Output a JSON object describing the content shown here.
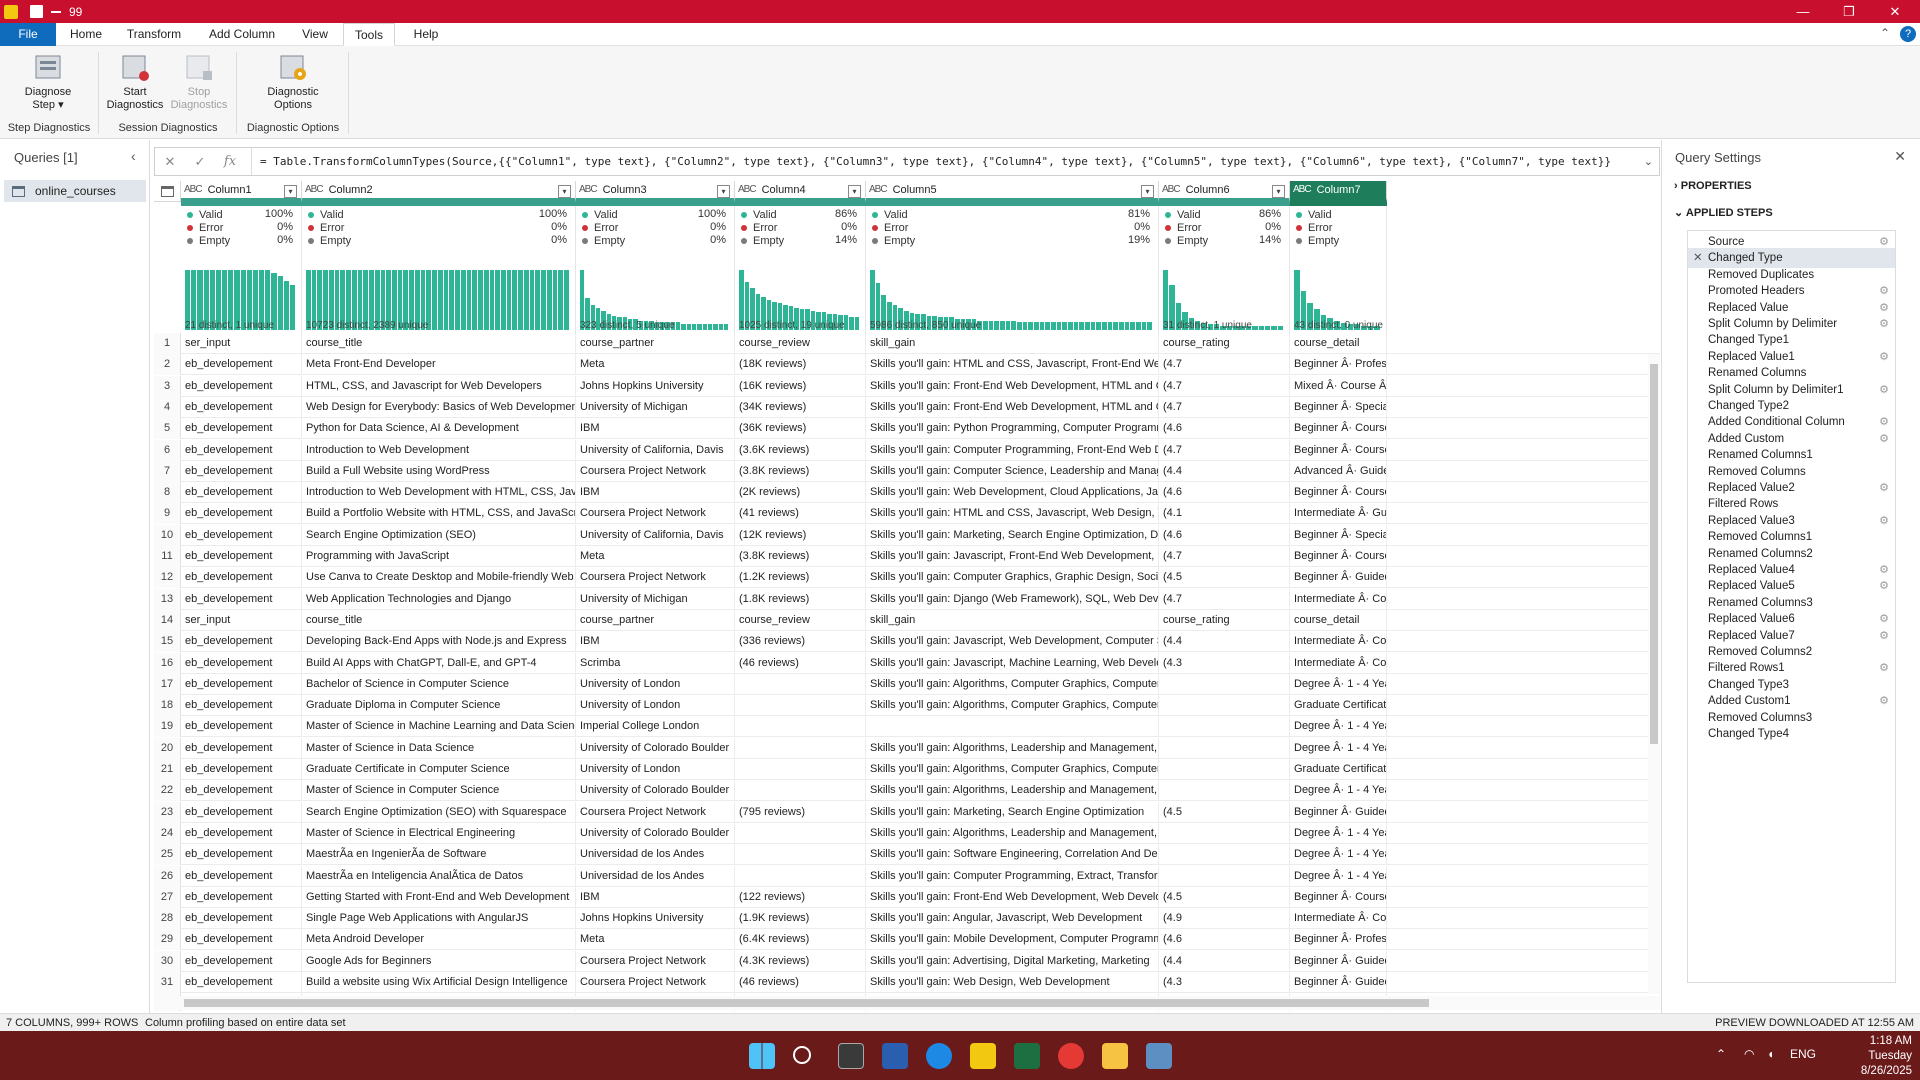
{
  "window": {
    "title": "99",
    "colors": {
      "titlebar": "#c8102e",
      "accent": "#0f6cbd",
      "profile_bar": "#2db596",
      "selected_header": "#1e7e5c"
    }
  },
  "menu": {
    "tabs": [
      "File",
      "Home",
      "Transform",
      "Add Column",
      "View",
      "Tools",
      "Help"
    ],
    "active": "Tools"
  },
  "ribbon": {
    "buttons": [
      {
        "label": "Diagnose\nStep ▾",
        "icon": "diagnose-icon",
        "enabled": true
      },
      {
        "label": "Start\nDiagnostics",
        "icon": "start-diagnostics-icon",
        "enabled": true
      },
      {
        "label": "Stop\nDiagnostics",
        "icon": "stop-diagnostics-icon",
        "enabled": false
      },
      {
        "label": "Diagnostic\nOptions",
        "icon": "diagnostic-options-icon",
        "enabled": true
      }
    ],
    "groups": [
      "Step Diagnostics",
      "Session Diagnostics",
      "Diagnostic Options"
    ]
  },
  "queries": {
    "header": "Queries [1]",
    "items": [
      "online_courses"
    ]
  },
  "formula": "= Table.TransformColumnTypes(Source,{{\"Column1\", type text}, {\"Column2\", type text}, {\"Column3\", type text}, {\"Column4\", type text}, {\"Column5\", type text}, {\"Column6\", type text}, {\"Column7\", type text}}",
  "columns": [
    {
      "name": "Column1",
      "valid": "100%",
      "error": "0%",
      "empty": "0%",
      "distinct": "21 distinct, 1 unique",
      "hist": [
        40,
        40,
        40,
        40,
        40,
        40,
        40,
        40,
        40,
        40,
        40,
        40,
        40,
        40,
        38,
        36,
        33,
        30
      ]
    },
    {
      "name": "Column2",
      "valid": "100%",
      "error": "0%",
      "empty": "0%",
      "distinct": "10723 distinct, 2389 unique",
      "hist": [
        40,
        40,
        40,
        40,
        40,
        40,
        40,
        40,
        40,
        40,
        40,
        40,
        40,
        40,
        40,
        40,
        40,
        40,
        40,
        40,
        40,
        40,
        40,
        40,
        40,
        40,
        40,
        40,
        40,
        40,
        40,
        40,
        40,
        40,
        40,
        40,
        40,
        40,
        40,
        40,
        40,
        40,
        40,
        40,
        40,
        40
      ]
    },
    {
      "name": "Column3",
      "valid": "100%",
      "error": "0%",
      "empty": "0%",
      "distinct": "323 distinct, 5 unique",
      "hist": [
        38,
        20,
        16,
        14,
        12,
        10,
        9,
        8,
        8,
        7,
        7,
        6,
        6,
        6,
        5,
        5,
        5,
        5,
        5,
        4,
        4,
        4,
        4,
        4,
        4,
        4,
        4,
        4
      ]
    },
    {
      "name": "Column4",
      "valid": "86%",
      "error": "0%",
      "empty": "14%",
      "distinct": "1025 distinct, 19 unique",
      "hist": [
        40,
        32,
        28,
        24,
        22,
        20,
        19,
        18,
        17,
        16,
        15,
        14,
        14,
        13,
        12,
        12,
        11,
        11,
        10,
        10,
        9,
        9
      ]
    },
    {
      "name": "Column5",
      "valid": "81%",
      "error": "0%",
      "empty": "19%",
      "distinct": "5986 distinct, 850 unique",
      "hist": [
        38,
        30,
        22,
        18,
        16,
        14,
        12,
        11,
        10,
        10,
        9,
        9,
        8,
        8,
        8,
        7,
        7,
        7,
        7,
        6,
        6,
        6,
        6,
        6,
        6,
        6,
        5,
        5,
        5,
        5,
        5,
        5,
        5,
        5,
        5,
        5,
        5,
        5,
        5,
        5,
        5,
        5,
        5,
        5,
        5,
        5,
        5,
        5,
        5,
        5
      ]
    },
    {
      "name": "Column6",
      "valid": "86%",
      "error": "0%",
      "empty": "14%",
      "distinct": "31 distinct, 1 unique",
      "hist": [
        40,
        30,
        18,
        12,
        8,
        6,
        5,
        4,
        4,
        3,
        3,
        3,
        3,
        3,
        3,
        3,
        3,
        3,
        3
      ]
    },
    {
      "name": "Column7",
      "valid": "",
      "error": "",
      "empty": "",
      "distinct": "43 distinct, 0 unique",
      "hist": [
        40,
        26,
        18,
        14,
        10,
        8,
        6,
        5,
        4,
        4,
        3,
        3,
        3
      ]
    }
  ],
  "profile_labels": {
    "valid": "Valid",
    "error": "Error",
    "empty": "Empty"
  },
  "rows": [
    [
      "ser_input",
      "course_title",
      "course_partner",
      "course_review",
      "skill_gain",
      "course_rating",
      "course_detail"
    ],
    [
      "eb_developement",
      "Meta Front-End Developer",
      "Meta",
      "(18K reviews)",
      "Skills you'll gain: HTML and CSS, Javascript, Front-End Web Developme...",
      "(4.7",
      "Beginner Â· Profess"
    ],
    [
      "eb_developement",
      "HTML, CSS, and Javascript for Web Developers",
      "Johns Hopkins University",
      "(16K reviews)",
      "Skills you'll gain: Front-End Web Development, HTML and CSS, Javascri...",
      "(4.7",
      "Mixed Â· Course Â·"
    ],
    [
      "eb_developement",
      "Web Design for Everybody: Basics of Web Development & Coding",
      "University of Michigan",
      "(34K reviews)",
      "Skills you'll gain: Front-End Web Development, HTML and CSS, Web D...",
      "(4.7",
      "Beginner Â· Speciali"
    ],
    [
      "eb_developement",
      "Python for Data Science, AI & Development",
      "IBM",
      "(36K reviews)",
      "Skills you'll gain: Python Programming, Computer Programming, Data ...",
      "(4.6",
      "Beginner Â· Course"
    ],
    [
      "eb_developement",
      "Introduction to Web Development",
      "University of California, Davis",
      "(3.6K reviews)",
      "Skills you'll gain: Computer Programming, Front-End Web Developmen...",
      "(4.7",
      "Beginner Â· Course"
    ],
    [
      "eb_developement",
      "Build a Full Website using WordPress",
      "Coursera Project Network",
      "(3.8K reviews)",
      "Skills you'll gain: Computer Science, Leadership and Management, Mar...",
      "(4.4",
      "Advanced Â· Guided"
    ],
    [
      "eb_developement",
      "Introduction to Web Development with HTML, CSS, JavaScript",
      "IBM",
      "(2K reviews)",
      "Skills you'll gain: Web Development, Cloud Applications, Javascript",
      "(4.6",
      "Beginner Â· Course"
    ],
    [
      "eb_developement",
      "Build a Portfolio Website with HTML, CSS, and JavaScript",
      "Coursera Project Network",
      "(41 reviews)",
      "Skills you'll gain: HTML and CSS, Javascript, Web Design, Web Develop...",
      "(4.1",
      "Intermediate Â· Gui"
    ],
    [
      "eb_developement",
      "Search Engine Optimization (SEO)",
      "University of California, Davis",
      "(12K reviews)",
      "Skills you'll gain: Marketing, Search Engine Optimization, Digital Marke...",
      "(4.6",
      "Beginner Â· Speciali"
    ],
    [
      "eb_developement",
      "Programming with JavaScript",
      "Meta",
      "(3.8K reviews)",
      "Skills you'll gain: Javascript, Front-End Web Development, Computer P...",
      "(4.7",
      "Beginner Â· Course"
    ],
    [
      "eb_developement",
      "Use Canva to Create Desktop and Mobile-friendly Web Pages.",
      "Coursera Project Network",
      "(1.2K reviews)",
      "Skills you'll gain: Computer Graphics, Graphic Design, Social Media, W...",
      "(4.5",
      "Beginner Â· Guided"
    ],
    [
      "eb_developement",
      "Web Application Technologies and Django",
      "University of Michigan",
      "(1.8K reviews)",
      "Skills you'll gain: Django (Web Framework), SQL, Web Development",
      "(4.7",
      "Intermediate Â· Co"
    ],
    [
      "ser_input",
      "course_title",
      "course_partner",
      "course_review",
      "skill_gain",
      "course_rating",
      "course_detail"
    ],
    [
      "eb_developement",
      "Developing Back-End Apps with Node.js and Express",
      "IBM",
      "(336 reviews)",
      "Skills you'll gain: Javascript, Web Development, Computer Science",
      "(4.4",
      "Intermediate Â· Co"
    ],
    [
      "eb_developement",
      "Build AI Apps with ChatGPT, Dall-E, and GPT-4",
      "Scrimba",
      "(46 reviews)",
      "Skills you'll gain: Javascript, Machine Learning, Web Development, We...",
      "(4.3",
      "Intermediate Â· Co"
    ],
    [
      "eb_developement",
      "Bachelor of Science in Computer Science",
      "University of London",
      "",
      "Skills you'll gain: Algorithms, Computer Graphics, Computer Programm...",
      "",
      "Degree Â· 1 - 4 Year"
    ],
    [
      "eb_developement",
      "Graduate Diploma in Computer Science",
      "University of London",
      "",
      "Skills you'll gain: Algorithms, Computer Graphics, Computer Programm...",
      "",
      "Graduate Certificat"
    ],
    [
      "eb_developement",
      "Master of Science in Machine Learning and Data Science",
      "Imperial College London",
      "",
      "",
      "",
      "Degree Â· 1 - 4 Year"
    ],
    [
      "eb_developement",
      "Master of Science in Data Science",
      "University of Colorado Boulder",
      "",
      "Skills you'll gain: Algorithms, Leadership and Management, Mathemati...",
      "",
      "Degree Â· 1 - 4 Year"
    ],
    [
      "eb_developement",
      "Graduate Certificate in Computer Science",
      "University of London",
      "",
      "Skills you'll gain: Algorithms, Computer Graphics, Computer Programm...",
      "",
      "Graduate Certificat"
    ],
    [
      "eb_developement",
      "Master of Science in Computer Science",
      "University of Colorado Boulder",
      "",
      "Skills you'll gain: Algorithms, Leadership and Management, Mathemati...",
      "",
      "Degree Â· 1 - 4 Year"
    ],
    [
      "eb_developement",
      "Search Engine Optimization (SEO) with Squarespace",
      "Coursera Project Network",
      "(795 reviews)",
      "Skills you'll gain: Marketing, Search Engine Optimization",
      "(4.5",
      "Beginner Â· Guided"
    ],
    [
      "eb_developement",
      "Master of Science in Electrical Engineering",
      "University of Colorado Boulder",
      "",
      "Skills you'll gain: Algorithms, Leadership and Management, Mathemati...",
      "",
      "Degree Â· 1 - 4 Year"
    ],
    [
      "eb_developement",
      "MaestrÃa en IngenierÃa de Software",
      "Universidad de los Andes",
      "",
      "Skills you'll gain: Software Engineering, Correlation And Dependence, S...",
      "",
      "Degree Â· 1 - 4 Year"
    ],
    [
      "eb_developement",
      "MaestrÃa en Inteligencia AnalÃtica de Datos",
      "Universidad de los Andes",
      "",
      "Skills you'll gain: Computer Programming, Extract, Transform, Load, Lo...",
      "",
      "Degree Â· 1 - 4 Year"
    ],
    [
      "eb_developement",
      "Getting Started with Front-End and Web Development",
      "IBM",
      "(122 reviews)",
      "Skills you'll gain: Front-End Web Development, Web Development",
      "(4.5",
      "Beginner Â· Course"
    ],
    [
      "eb_developement",
      "Single Page Web Applications with AngularJS",
      "Johns Hopkins University",
      "(1.9K reviews)",
      "Skills you'll gain: Angular, Javascript, Web Development",
      "(4.9",
      "Intermediate Â· Co"
    ],
    [
      "eb_developement",
      "Meta Android Developer",
      "Meta",
      "(6.4K reviews)",
      "Skills you'll gain: Mobile Development, Computer Programming, React ...",
      "(4.6",
      "Beginner Â· Profess"
    ],
    [
      "eb_developement",
      "Google Ads for Beginners",
      "Coursera Project Network",
      "(4.3K reviews)",
      "Skills you'll gain: Advertising, Digital Marketing, Marketing",
      "(4.4",
      "Beginner Â· Guided"
    ],
    [
      "eb_developement",
      "Build a website using Wix Artificial Design Intelligence",
      "Coursera Project Network",
      "(46 reviews)",
      "Skills you'll gain: Web Design, Web Development",
      "(4.3",
      "Beginner Â· Guided"
    ],
    [
      "",
      "",
      "",
      "",
      "",
      "",
      ""
    ]
  ],
  "query_settings": {
    "header": "Query Settings",
    "properties_label": "PROPERTIES",
    "applied_steps_label": "APPLIED STEPS",
    "steps": [
      {
        "name": "Source",
        "gear": true
      },
      {
        "name": "Changed Type",
        "gear": false,
        "selected": true
      },
      {
        "name": "Removed Duplicates",
        "gear": false
      },
      {
        "name": "Promoted Headers",
        "gear": true
      },
      {
        "name": "Replaced Value",
        "gear": true
      },
      {
        "name": "Split Column by Delimiter",
        "gear": true
      },
      {
        "name": "Changed Type1",
        "gear": false
      },
      {
        "name": "Replaced Value1",
        "gear": true
      },
      {
        "name": "Renamed Columns",
        "gear": false
      },
      {
        "name": "Split Column by Delimiter1",
        "gear": true
      },
      {
        "name": "Changed Type2",
        "gear": false
      },
      {
        "name": "Added Conditional Column",
        "gear": true
      },
      {
        "name": "Added Custom",
        "gear": true
      },
      {
        "name": "Renamed Columns1",
        "gear": false
      },
      {
        "name": "Removed Columns",
        "gear": false
      },
      {
        "name": "Replaced Value2",
        "gear": true
      },
      {
        "name": "Filtered Rows",
        "gear": false
      },
      {
        "name": "Replaced Value3",
        "gear": true
      },
      {
        "name": "Removed Columns1",
        "gear": false
      },
      {
        "name": "Renamed Columns2",
        "gear": false
      },
      {
        "name": "Replaced Value4",
        "gear": true
      },
      {
        "name": "Replaced Value5",
        "gear": true
      },
      {
        "name": "Renamed Columns3",
        "gear": false
      },
      {
        "name": "Replaced Value6",
        "gear": true
      },
      {
        "name": "Replaced Value7",
        "gear": true
      },
      {
        "name": "Removed Columns2",
        "gear": false
      },
      {
        "name": "Filtered Rows1",
        "gear": true
      },
      {
        "name": "Changed Type3",
        "gear": false
      },
      {
        "name": "Added Custom1",
        "gear": true
      },
      {
        "name": "Removed Columns3",
        "gear": false
      },
      {
        "name": "Changed Type4",
        "gear": false
      }
    ]
  },
  "status": {
    "left": "7 COLUMNS, 999+ ROWS",
    "profiling": "Column profiling based on entire data set",
    "right": "PREVIEW DOWNLOADED AT 12:55 AM"
  },
  "taskbar": {
    "lang": "ENG",
    "time": "1:18 AM",
    "day": "Tuesday",
    "date": "8/26/2025"
  }
}
